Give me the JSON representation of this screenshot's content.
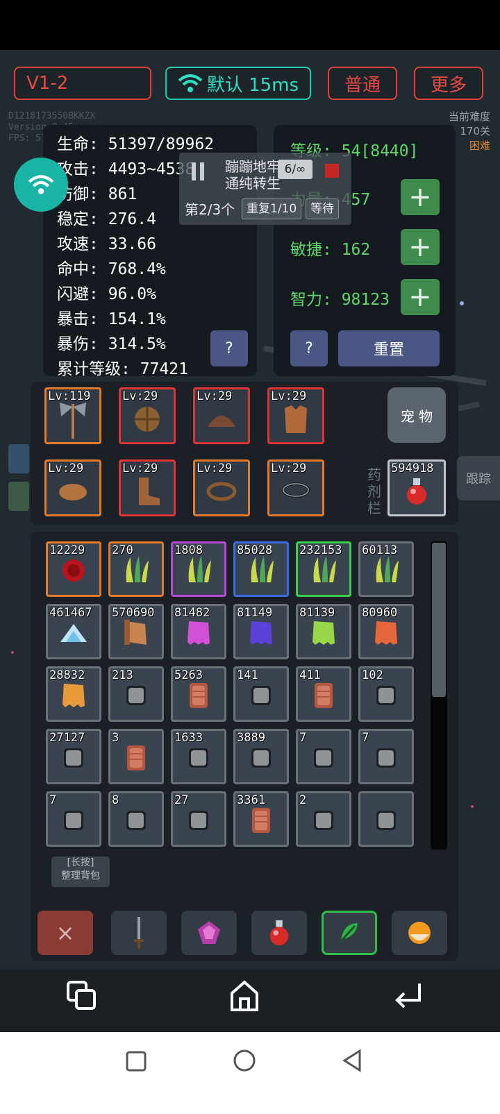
{
  "topbar": {
    "stage": "V1-2",
    "network": "默认 15ms",
    "mode": "普通",
    "more": "更多"
  },
  "debug": {
    "line1": "D1218173550BKKZX",
    "line2": "Version 0.45",
    "line3": "FPS: 57"
  },
  "difficulty": {
    "label": "当前难度",
    "stage": "170关",
    "level": "困难"
  },
  "stats": {
    "hp": "生命: 51397/89962",
    "atk": "攻击: 4493~4538",
    "def": "防御: 861",
    "stable": "稳定: 276.4",
    "aspd": "攻速: 33.66",
    "hit": "命中: 768.4%",
    "dodge": "闪避: 96.0%",
    "crit": "暴击: 154.1%",
    "critdmg": "暴伤: 314.5%",
    "total": "累计等级: 77421",
    "help": "?"
  },
  "attrs": {
    "level": "等级: 54[8440]",
    "str": "力量: 457",
    "agi": "敏捷: 162",
    "int": "智力: 98123",
    "plus": "+",
    "help": "?",
    "reset": "重置"
  },
  "overlay": {
    "task_line1": "蹦蹦地牢首",
    "task_line2": "通纯转生",
    "count": "6/∞",
    "progress": "第2/3个",
    "repeat": "重复1/10",
    "wait": "等待"
  },
  "equipment": [
    {
      "level": "Lv:119",
      "icon": "axe-icon"
    },
    {
      "level": "Lv:29",
      "icon": "shield-icon"
    },
    {
      "level": "Lv:29",
      "icon": "helmet-icon"
    },
    {
      "level": "Lv:29",
      "icon": "armor-icon"
    },
    {
      "level": "Lv:29",
      "icon": "gloves-icon"
    },
    {
      "level": "Lv:29",
      "icon": "boots-icon"
    },
    {
      "level": "Lv:29",
      "icon": "ring-icon"
    },
    {
      "level": "Lv:29",
      "icon": "necklace-icon"
    }
  ],
  "pet_label": "宠 物",
  "potion_label": "药剂栏",
  "potion_count": "594918",
  "side_label": "跟踪",
  "inventory": [
    [
      "12229",
      "270",
      "1808",
      "85028",
      "232153",
      "60113"
    ],
    [
      "461467",
      "570690",
      "81482",
      "81149",
      "81139",
      "80960"
    ],
    [
      "28832",
      "213",
      "5263",
      "141",
      "411",
      "102"
    ],
    [
      "27127",
      "3",
      "1633",
      "3889",
      "7",
      "7"
    ],
    [
      "7",
      "8",
      "27",
      "3361",
      "2",
      ""
    ]
  ],
  "sort_label1": "[长按]",
  "sort_label2": "整理背包",
  "close_label": "×",
  "colors": {
    "accent_red": "#e0413a",
    "accent_teal": "#1ec9b0",
    "attr_green": "#5fd86a",
    "plus_green": "#3f8b4e"
  }
}
